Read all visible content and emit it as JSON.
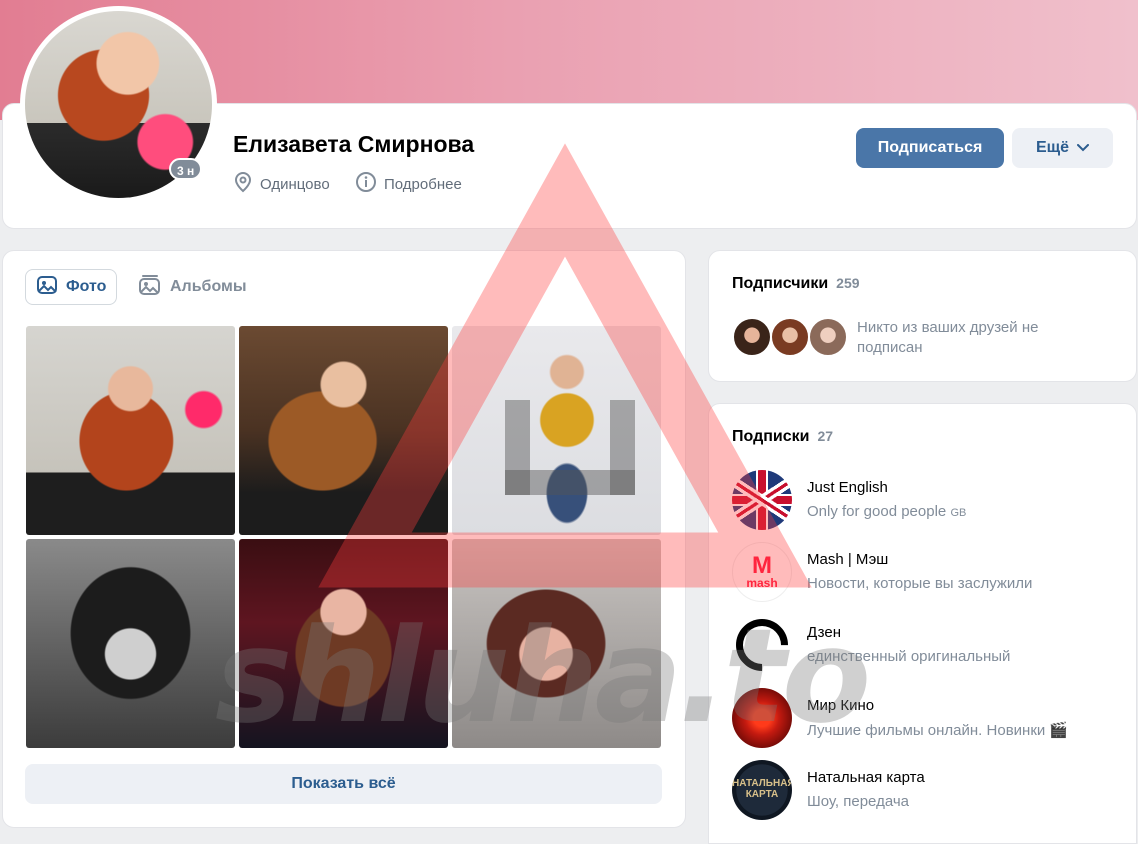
{
  "profile": {
    "name": "Елизавета Смирнова",
    "online_badge": "3 н",
    "city": "Одинцово",
    "details_link": "Подробнее",
    "subscribe_button": "Подписаться",
    "more_button": "Ещё"
  },
  "photos": {
    "tabs": [
      {
        "label": "Фото",
        "active": true
      },
      {
        "label": "Альбомы",
        "active": false
      }
    ],
    "show_all": "Показать всё"
  },
  "followers": {
    "title": "Подписчики",
    "count": "259",
    "note": "Никто из ваших друзей не подписан"
  },
  "following": {
    "title": "Подписки",
    "count": "27",
    "items": [
      {
        "name": "Just English",
        "desc": "Only for good people",
        "desc_suffix": "GB",
        "icon": "uk-flag"
      },
      {
        "name": "Mash | Мэш",
        "desc": "Новости, которые вы заслужили",
        "icon": "mash-logo"
      },
      {
        "name": "Дзен",
        "desc": "единственный оригинальный",
        "icon": "dzen-logo"
      },
      {
        "name": "Мир Кино",
        "desc": "Лучшие фильмы онлайн. Новинки 🎬",
        "icon": "kino-logo"
      },
      {
        "name": "Натальная карта",
        "desc": "Шоу, передача",
        "icon": "natal-logo"
      }
    ]
  },
  "logos": {
    "mash_text": "mash",
    "natal_text": "НАТАЛЬНАЯ КАРТА"
  },
  "watermark": {
    "text": "shluha.to",
    "color": "#ff3b3b"
  },
  "colors": {
    "accent": "#4a76a8",
    "link": "#2c5d8f",
    "muted": "#818c99"
  }
}
